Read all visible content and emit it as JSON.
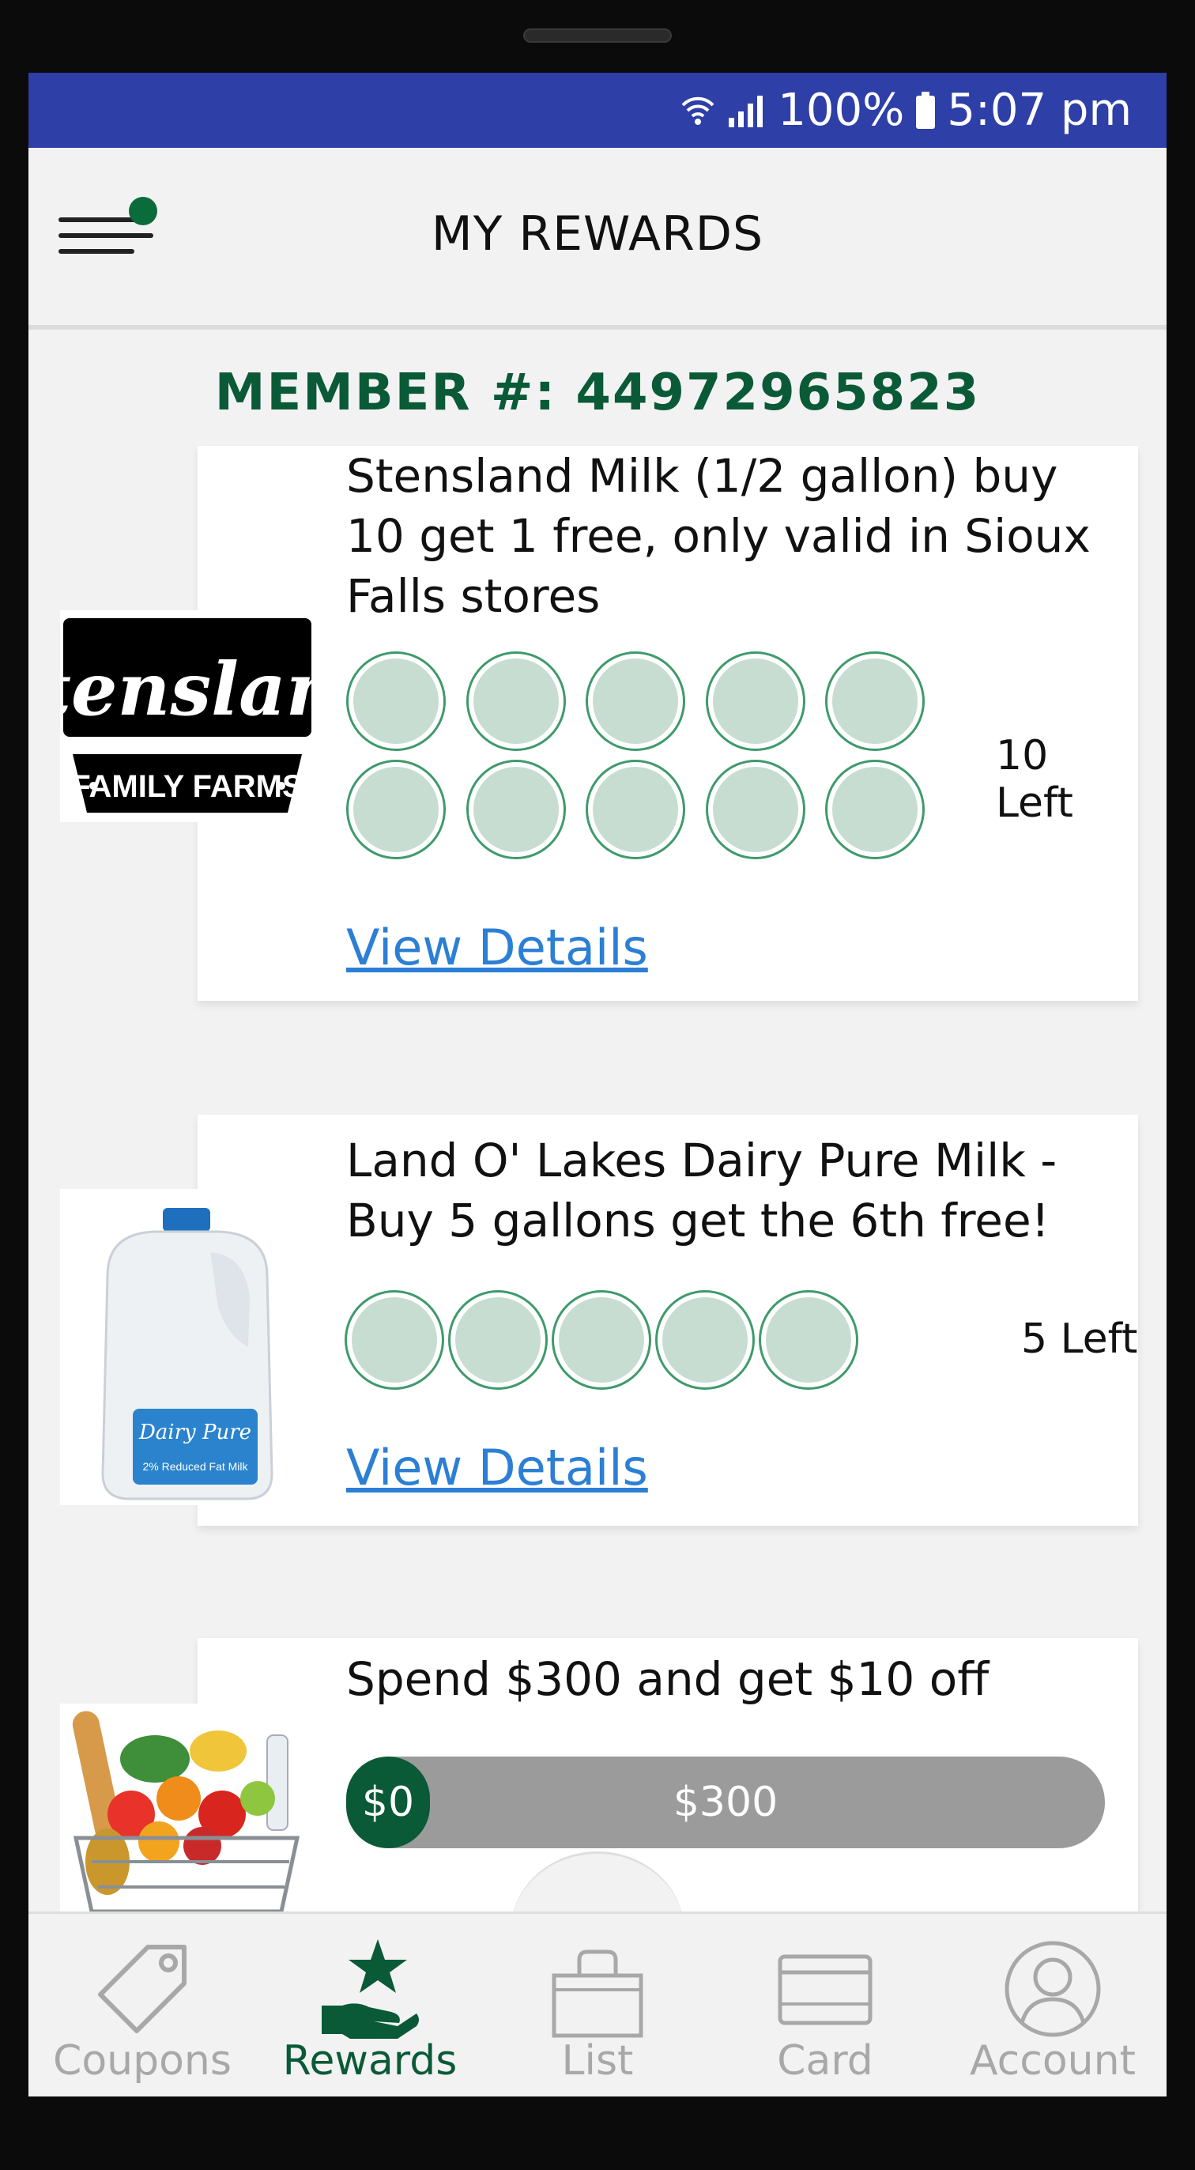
{
  "status_bar": {
    "battery": "100%",
    "time": "5:07 pm"
  },
  "header": {
    "title": "MY REWARDS"
  },
  "member": {
    "label": "MEMBER #: 44972965823"
  },
  "rewards": [
    {
      "title": "Stensland Milk (1/2 gallon) buy 10 get 1 free, only valid in Sioux Falls stores",
      "logo_line1": "Stensland",
      "logo_line2": "FAMILY FARMS",
      "stamps_total": 10,
      "stamps_filled": 0,
      "remaining": "10 Left",
      "link": "View Details"
    },
    {
      "title": "Land O' Lakes Dairy Pure Milk - Buy 5 gallons get the 6th free!",
      "jug_brand": "Dairy Pure",
      "jug_label": "2% Reduced Fat Milk",
      "stamps_total": 5,
      "stamps_filled": 0,
      "remaining": "5 Left",
      "link": "View Details"
    },
    {
      "title": "Spend $300 and get $10 off",
      "progress_current": "$0",
      "progress_target": "$300",
      "progress_fraction": 0.0
    }
  ],
  "nav": [
    {
      "label": "Coupons",
      "icon": "tag-icon"
    },
    {
      "label": "Rewards",
      "icon": "rewards-star-hand-icon"
    },
    {
      "label": "List",
      "icon": "bag-icon"
    },
    {
      "label": "Card",
      "icon": "card-icon"
    },
    {
      "label": "Account",
      "icon": "account-icon"
    }
  ],
  "colors": {
    "status_bar": "#2e3fa8",
    "brand_green": "#0a5a37",
    "link": "#2b7fd4"
  }
}
